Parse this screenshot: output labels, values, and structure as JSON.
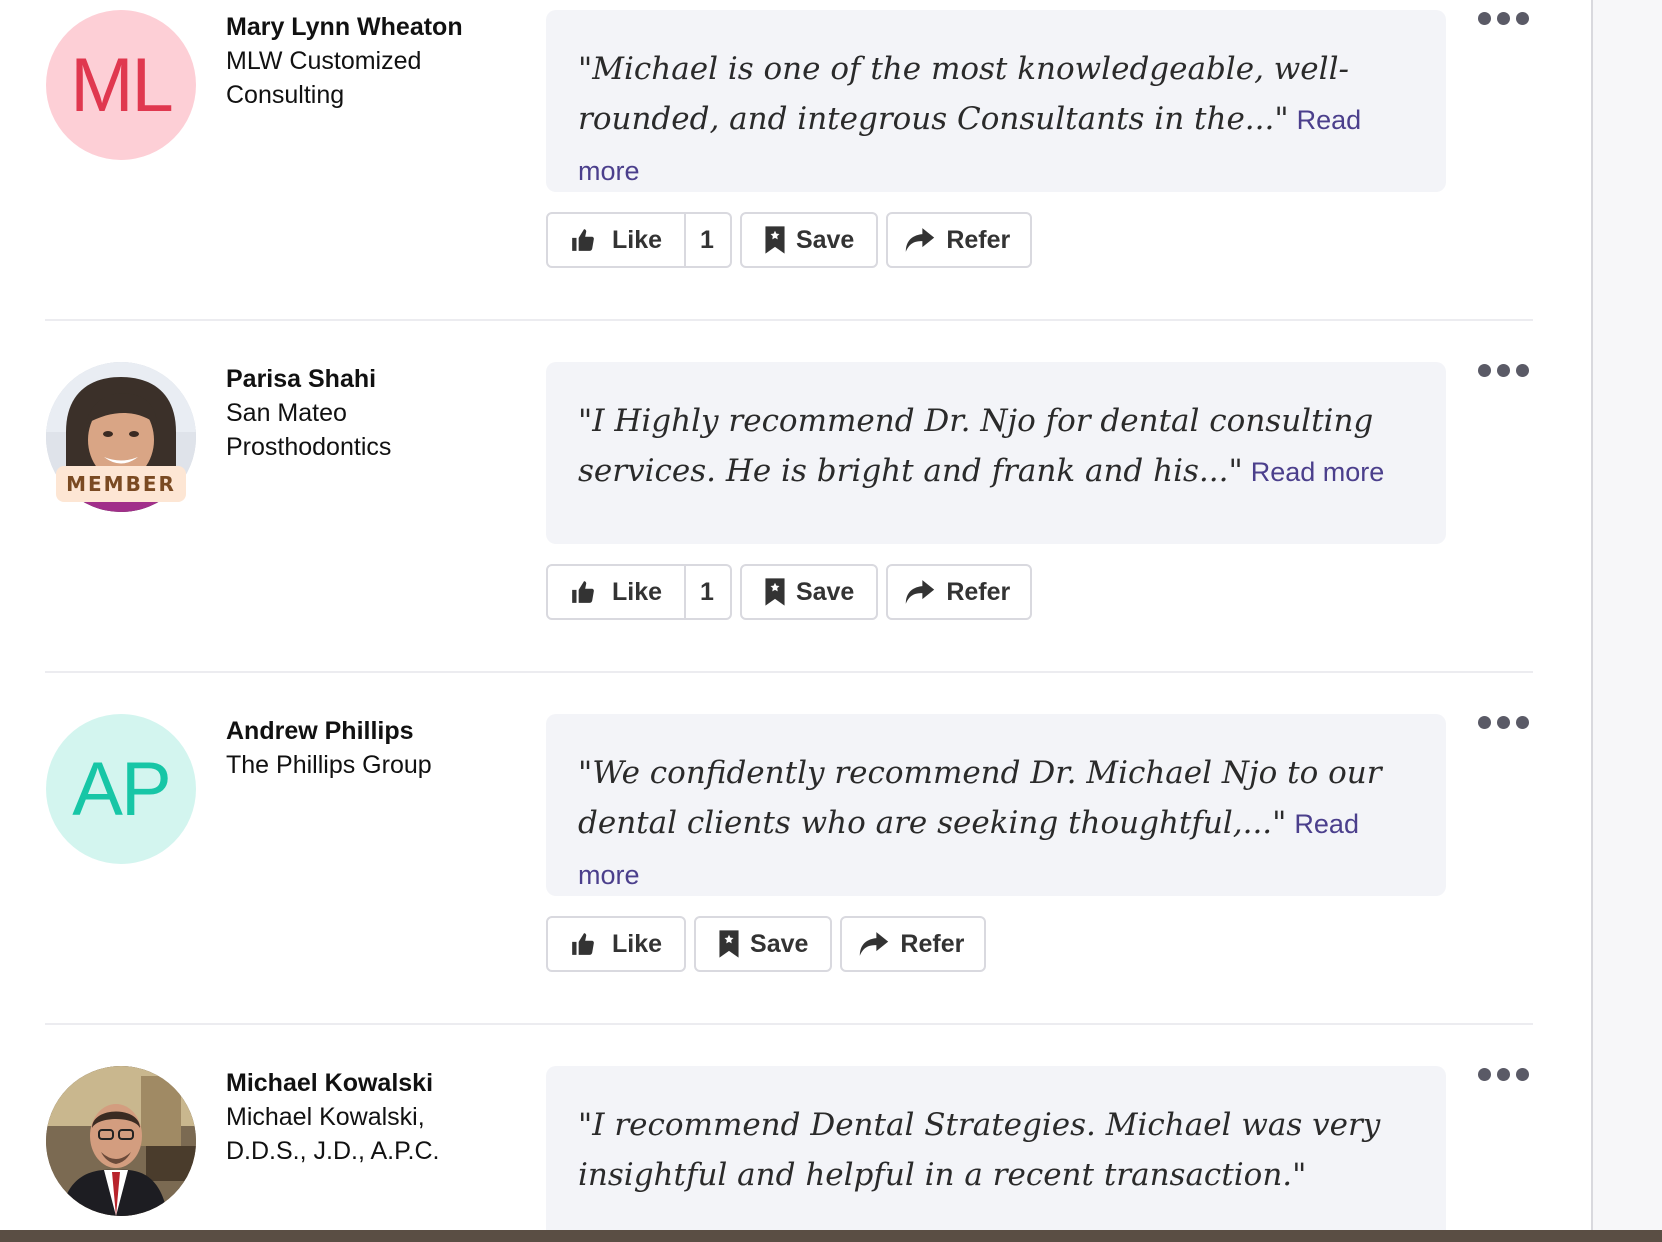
{
  "recommendations": [
    {
      "avatar": {
        "initials": "ML",
        "color": "#e0384f",
        "bg": "#fdcfd6"
      },
      "name": "Mary Lynn Wheaton",
      "company_lines": [
        "MLW Customized",
        "Consulting"
      ],
      "quote": "\"Michael is one of the most knowledgeable, well-rounded, and integrous Consultants in the...\"",
      "read_more": "Read more",
      "like_label": "Like",
      "like_count": "1",
      "save_label": "Save",
      "refer_label": "Refer"
    },
    {
      "avatar": {
        "photo": "woman-smiling-portrait"
      },
      "badge": "MEMBER",
      "name": "Parisa Shahi",
      "company_lines": [
        "San Mateo",
        "Prosthodontics"
      ],
      "quote": "\"I Highly recommend Dr. Njo for dental consulting services. He is bright and frank and his...\"",
      "read_more": "Read more",
      "like_label": "Like",
      "like_count": "1",
      "save_label": "Save",
      "refer_label": "Refer"
    },
    {
      "avatar": {
        "initials": "AP",
        "color": "#17c6a6",
        "bg": "#d3f5ef"
      },
      "name": "Andrew Phillips",
      "company_lines": [
        "The Phillips Group"
      ],
      "quote": "\"We confidently recommend Dr. Michael Njo to our dental clients who are seeking thoughtful,...\"",
      "read_more": "Read more",
      "like_label": "Like",
      "save_label": "Save",
      "refer_label": "Refer"
    },
    {
      "avatar": {
        "photo": "man-in-suit-office-portrait"
      },
      "name": "Michael Kowalski",
      "company_lines": [
        "Michael Kowalski,",
        "D.D.S., J.D., A.P.C."
      ],
      "quote": "\"I recommend Dental Strategies. Michael was very insightful and helpful in a recent transaction.\""
    }
  ],
  "icons": {
    "more": "ellipsis-icon",
    "like": "thumbs-up-icon",
    "save": "bookmark-icon",
    "refer": "share-arrow-icon"
  },
  "colors": {
    "link": "#4b3f8c",
    "quote_bg": "#f3f4f8"
  }
}
